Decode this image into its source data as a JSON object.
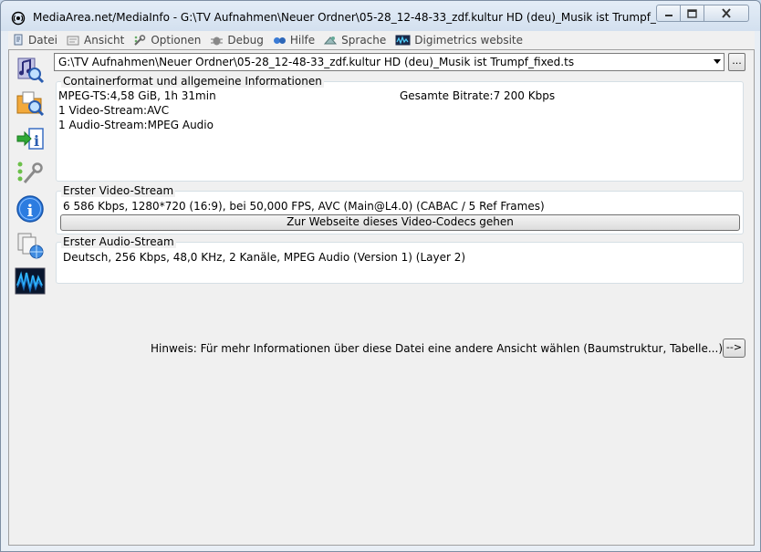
{
  "window": {
    "title": "MediaArea.net/MediaInfo - G:\\TV Aufnahmen\\Neuer Ordner\\05-28_12-48-33_zdf.kultur HD (deu)_Musik ist Trumpf_fixed.ts"
  },
  "menu": {
    "items": [
      {
        "label": "Datei",
        "icon": "file-icon"
      },
      {
        "label": "Ansicht",
        "icon": "view-icon"
      },
      {
        "label": "Optionen",
        "icon": "options-icon"
      },
      {
        "label": "Debug",
        "icon": "debug-icon"
      },
      {
        "label": "Hilfe",
        "icon": "help-icon"
      },
      {
        "label": "Sprache",
        "icon": "language-icon"
      },
      {
        "label": "Digimetrics website",
        "icon": "digimetrics-icon"
      }
    ]
  },
  "file_selector": {
    "value": "G:\\TV Aufnahmen\\Neuer Ordner\\05-28_12-48-33_zdf.kultur HD (deu)_Musik ist Trumpf_fixed.ts",
    "browse_label": "..."
  },
  "general": {
    "title": "Containerformat und allgemeine Informationen",
    "format_line": "MPEG-TS:4,58 GiB, 1h 31min",
    "bitrate_line": "Gesamte Bitrate:7 200 Kbps",
    "video_count": "1 Video-Stream:AVC",
    "audio_count": "1 Audio-Stream:MPEG Audio"
  },
  "video": {
    "title": "Erster Video-Stream",
    "details": "6 586 Kbps, 1280*720 (16:9), bei 50,000 FPS, AVC (Main@L4.0) (CABAC / 5 Ref Frames)",
    "codec_button": "Zur Webseite dieses Video-Codecs gehen"
  },
  "audio": {
    "title": "Erster Audio-Stream",
    "details": "Deutsch, 256 Kbps, 48,0 KHz, 2 Kanäle, MPEG Audio (Version 1) (Layer 2)"
  },
  "hint": {
    "text": "Hinweis: Für mehr Informationen über diese Datei eine andere Ansicht wählen (Baumstruktur, Tabelle...)",
    "button": "-->"
  },
  "colors": {
    "accent": "#1e6fd0",
    "window_bg": "#f0f0f0"
  }
}
